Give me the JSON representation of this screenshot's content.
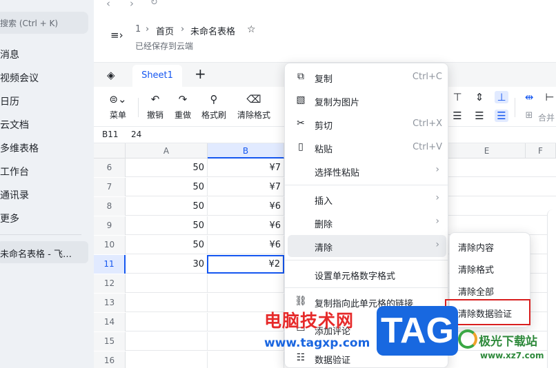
{
  "sidebar": {
    "search_placeholder": "搜索 (Ctrl + K)",
    "items": [
      {
        "label": "消息"
      },
      {
        "label": "视频会议"
      },
      {
        "label": "日历"
      },
      {
        "label": "云文档"
      },
      {
        "label": "多维表格"
      },
      {
        "label": "工作台"
      },
      {
        "label": "通讯录"
      },
      {
        "label": "更多"
      }
    ],
    "recent": "未命名表格 - 飞…"
  },
  "header": {
    "crumb_num": "1",
    "crumb_home": "首页",
    "doc_title": "未命名表格",
    "saved_status": "已经保存到云端"
  },
  "sheet": {
    "tab_label": "Sheet1"
  },
  "toolbar": {
    "menu_label": "菜单",
    "undo_label": "撤销",
    "redo_label": "重做",
    "format_painter_label": "格式刷",
    "clear_format_label": "清除格式",
    "merge_label": "合并"
  },
  "formula": {
    "cell_ref": "B11",
    "value": "24"
  },
  "grid": {
    "columns": [
      "A",
      "B",
      "E",
      "F"
    ],
    "rows": [
      {
        "num": "6",
        "a": "50",
        "b": "¥7"
      },
      {
        "num": "7",
        "a": "50",
        "b": "¥7"
      },
      {
        "num": "8",
        "a": "50",
        "b": "¥6"
      },
      {
        "num": "9",
        "a": "50",
        "b": "¥6"
      },
      {
        "num": "10",
        "a": "50",
        "b": "¥6"
      },
      {
        "num": "11",
        "a": "30",
        "b": "¥2"
      },
      {
        "num": "12",
        "a": "",
        "b": ""
      },
      {
        "num": "13",
        "a": "",
        "b": ""
      },
      {
        "num": "14",
        "a": "",
        "b": ""
      },
      {
        "num": "15",
        "a": "",
        "b": ""
      },
      {
        "num": "16",
        "a": "",
        "b": ""
      }
    ]
  },
  "context_menu": {
    "copy": "复制",
    "copy_shortcut": "Ctrl+C",
    "copy_as_image": "复制为图片",
    "cut": "剪切",
    "cut_shortcut": "Ctrl+X",
    "paste": "粘贴",
    "paste_shortcut": "Ctrl+V",
    "paste_special": "选择性粘贴",
    "insert": "插入",
    "delete": "删除",
    "clear": "清除",
    "number_format": "设置单元格数字格式",
    "copy_link": "复制指向此单元格的链接",
    "add_comment": "添加评论",
    "data_validation": "数据验证"
  },
  "clear_submenu": {
    "clear_content": "清除内容",
    "clear_format": "清除格式",
    "clear_all": "清除全部",
    "clear_validation": "清除数据验证"
  },
  "watermark": {
    "site_name": "电脑技术网",
    "site_url": "www.tagxp.com",
    "tag": "TAG",
    "xz_name": "极光下载站",
    "xz_url": "www.xz7.com"
  },
  "colors": {
    "accent": "#1456f0",
    "highlight_border": "#d81e1e"
  }
}
